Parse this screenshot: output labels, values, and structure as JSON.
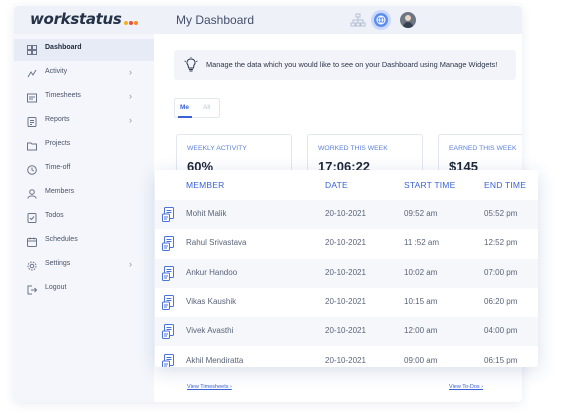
{
  "app": {
    "logo_text": "workstatus",
    "logo_dot_colors": [
      "#f2b01e",
      "#e8503a",
      "#f28c1e"
    ],
    "page_title": "My Dashboard",
    "accent_color": "#3a62d7"
  },
  "sidebar": {
    "collapse_icon": "double-chevron-left-icon",
    "items": [
      {
        "label": "Dashboard",
        "icon": "grid-icon",
        "active": true,
        "has_submenu": false
      },
      {
        "label": "Activity",
        "icon": "activity-icon",
        "active": false,
        "has_submenu": true
      },
      {
        "label": "Timesheets",
        "icon": "timesheet-icon",
        "active": false,
        "has_submenu": true
      },
      {
        "label": "Reports",
        "icon": "report-icon",
        "active": false,
        "has_submenu": true
      },
      {
        "label": "Projects",
        "icon": "folder-icon",
        "active": false,
        "has_submenu": false
      },
      {
        "label": "Time-off",
        "icon": "clock-icon",
        "active": false,
        "has_submenu": false
      },
      {
        "label": "Members",
        "icon": "user-icon",
        "active": false,
        "has_submenu": false
      },
      {
        "label": "Todos",
        "icon": "todo-icon",
        "active": false,
        "has_submenu": false
      },
      {
        "label": "Schedules",
        "icon": "calendar-icon",
        "active": false,
        "has_submenu": false
      },
      {
        "label": "Settings",
        "icon": "gear-icon",
        "active": false,
        "has_submenu": true
      },
      {
        "label": "Logout",
        "icon": "logout-icon",
        "active": false,
        "has_submenu": false
      }
    ]
  },
  "banner": {
    "text": "Manage the data which you would like to see on your Dashboard using Manage Widgets!"
  },
  "tabs": [
    {
      "label": "Me",
      "active": true
    },
    {
      "label": "All",
      "active": false
    }
  ],
  "stats": {
    "weekly_activity": {
      "label": "WEEKLY ACTIVITY",
      "value": "60%"
    },
    "worked_this_week": {
      "label": "WORKED THIS WEEK",
      "value": "17:06:22"
    },
    "earned_this_week": {
      "label": "EARNED THIS WEEK",
      "value": "$145"
    }
  },
  "links": {
    "view_timesheets": "View Timesheets  ›",
    "view_todos": "View To-Dos  ›"
  },
  "table": {
    "headers": {
      "member": "MEMBER",
      "date": "DATE",
      "start_time": "START TIME",
      "end_time": "END TIME"
    },
    "rows": [
      {
        "member": "Mohit Malik",
        "date": "20-10-2021",
        "start_time": "09:52 am",
        "end_time": "05:52 pm"
      },
      {
        "member": "Rahul Srivastava",
        "date": "20-10-2021",
        "start_time": "11 :52 am",
        "end_time": "12:52 pm"
      },
      {
        "member": "Ankur Handoo",
        "date": "20-10-2021",
        "start_time": "10:02 am",
        "end_time": "07:00 pm"
      },
      {
        "member": "Vikas Kaushik",
        "date": "20-10-2021",
        "start_time": "10:15 am",
        "end_time": "06:20 pm"
      },
      {
        "member": "Vivek Avasthi",
        "date": "20-10-2021",
        "start_time": "12:00 am",
        "end_time": "04:00 pm"
      },
      {
        "member": "Akhil Mendiratta",
        "date": "20-10-2021",
        "start_time": "09:00 am",
        "end_time": "06:15 pm"
      }
    ]
  }
}
